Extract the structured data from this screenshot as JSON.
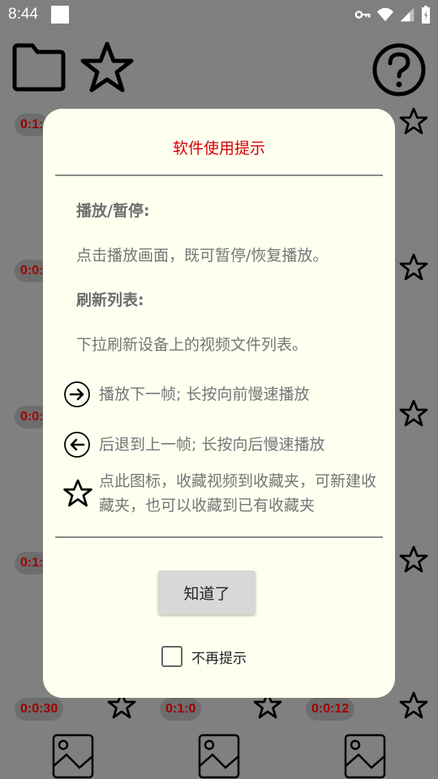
{
  "status_bar": {
    "time": "8:44"
  },
  "background_grid": {
    "badges": [
      "0:1:",
      "0:0:",
      "0:0:",
      "0:1:",
      "0:0:30",
      "0:1:0",
      "0:0:12"
    ]
  },
  "dialog": {
    "title": "软件使用提示",
    "sections": [
      {
        "heading": "播放/暂停:",
        "text": "点击播放画面，既可暂停/恢复播放。"
      },
      {
        "heading": "刷新列表:",
        "text": "下拉刷新设备上的视频文件列表。"
      }
    ],
    "icon_rows": [
      {
        "icon": "arrow-right-circle-icon",
        "text": "播放下一帧; 长按向前慢速播放"
      },
      {
        "icon": "arrow-left-circle-icon",
        "text": "后退到上一帧; 长按向后慢速播放"
      },
      {
        "icon": "star-outline-icon",
        "text": "点此图标，收藏视频到收藏夹，可新建收藏夹，也可以收藏到已有收藏夹"
      }
    ],
    "ok_label": "知道了",
    "checkbox_label": "不再提示",
    "checkbox_checked": false
  },
  "colors": {
    "overlay_gray": "#808080",
    "dialog_bg": "#fffff0",
    "title_red": "#d40000",
    "badge_text": "#a00000"
  }
}
